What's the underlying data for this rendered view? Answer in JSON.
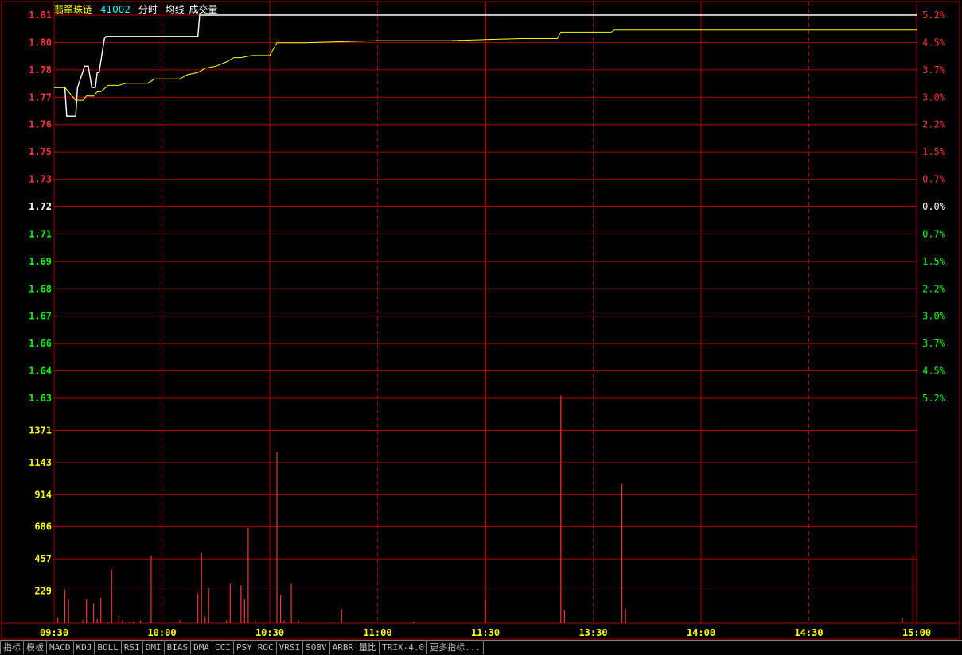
{
  "header": {
    "stock_name": "翡翠珠链",
    "stock_code": "41002",
    "legend": [
      "分时",
      "均线",
      "成交量"
    ]
  },
  "colors": {
    "price_line": "#ffffff",
    "avg_line": "#ffff00",
    "up": "#ff3232",
    "down": "#00ff00",
    "neutral": "#ffffff",
    "grid": "#b40000",
    "volume_axis": "#ffff00"
  },
  "bottom_tabs": [
    "指标",
    "模板",
    "MACD",
    "KDJ",
    "BOLL",
    "RSI",
    "DMI",
    "BIAS",
    "DMA",
    "CCI",
    "PSY",
    "ROC",
    "VRSI",
    "SOBV",
    "ARBR",
    "量比",
    "TRIX-4.0",
    "更多指标..."
  ],
  "chart_data": [
    {
      "type": "line",
      "title": "分时",
      "prev_close": 1.72,
      "price_ticks": [
        {
          "label": "1.81",
          "pct": "5.2%",
          "dir": "up"
        },
        {
          "label": "1.80",
          "pct": "4.5%",
          "dir": "up"
        },
        {
          "label": "1.78",
          "pct": "3.7%",
          "dir": "up"
        },
        {
          "label": "1.77",
          "pct": "3.0%",
          "dir": "up"
        },
        {
          "label": "1.76",
          "pct": "2.2%",
          "dir": "up"
        },
        {
          "label": "1.75",
          "pct": "1.5%",
          "dir": "up"
        },
        {
          "label": "1.73",
          "pct": "0.7%",
          "dir": "up"
        },
        {
          "label": "1.72",
          "pct": "0.0%",
          "dir": "flat"
        },
        {
          "label": "1.71",
          "pct": "0.7%",
          "dir": "down"
        },
        {
          "label": "1.69",
          "pct": "1.5%",
          "dir": "down"
        },
        {
          "label": "1.68",
          "pct": "2.2%",
          "dir": "down"
        },
        {
          "label": "1.67",
          "pct": "3.0%",
          "dir": "down"
        },
        {
          "label": "1.66",
          "pct": "3.7%",
          "dir": "down"
        },
        {
          "label": "1.64",
          "pct": "4.5%",
          "dir": "down"
        },
        {
          "label": "1.63",
          "pct": "5.2%",
          "dir": "down"
        }
      ],
      "ylim": [
        1.63,
        1.81
      ],
      "x_ticks": [
        "09:30",
        "10:00",
        "10:30",
        "11:00",
        "11:30",
        "13:30",
        "14:00",
        "14:30",
        "15:00"
      ],
      "series": [
        {
          "name": "分时",
          "x": [
            0,
            3,
            3.5,
            6,
            6.5,
            8.5,
            9.5,
            10.5,
            11.5,
            12,
            12.5,
            14,
            14.5,
            40,
            40.5,
            240
          ],
          "values": [
            1.776,
            1.776,
            1.7625,
            1.7625,
            1.776,
            1.786,
            1.786,
            1.776,
            1.776,
            1.783,
            1.783,
            1.799,
            1.8,
            1.8,
            1.81,
            1.81
          ]
        },
        {
          "name": "均线",
          "x": [
            0,
            3,
            6,
            8,
            9,
            11,
            12,
            13,
            15,
            18,
            20,
            26,
            28,
            35,
            37,
            40,
            42,
            45,
            48,
            50,
            52,
            55,
            60,
            62,
            64,
            70,
            90,
            110,
            130,
            140,
            141,
            155,
            156,
            240
          ],
          "values": [
            1.776,
            1.776,
            1.77,
            1.77,
            1.772,
            1.772,
            1.774,
            1.774,
            1.777,
            1.777,
            1.778,
            1.778,
            1.78,
            1.78,
            1.782,
            1.783,
            1.785,
            1.786,
            1.788,
            1.79,
            1.79,
            1.791,
            1.791,
            1.797,
            1.797,
            1.797,
            1.798,
            1.798,
            1.799,
            1.799,
            1.802,
            1.802,
            1.803,
            1.803
          ]
        }
      ]
    },
    {
      "type": "bar",
      "title": "成交量",
      "y_ticks": [
        "1371",
        "1143",
        "914",
        "686",
        "457",
        "229"
      ],
      "ylim": [
        0,
        1600
      ],
      "series": [
        {
          "name": "成交量",
          "x": [
            1,
            3,
            4,
            8,
            9,
            11,
            12,
            13,
            15,
            16,
            18,
            19,
            21,
            22,
            24,
            27,
            35,
            40,
            41,
            42,
            43,
            48,
            49,
            52,
            53,
            54,
            56,
            62,
            63,
            64,
            66,
            68,
            80,
            100,
            120,
            141,
            142,
            158,
            159,
            236,
            239
          ],
          "values": [
            40,
            240,
            170,
            20,
            170,
            140,
            30,
            180,
            10,
            380,
            50,
            20,
            10,
            10,
            20,
            480,
            20,
            210,
            500,
            50,
            250,
            20,
            280,
            270,
            170,
            680,
            20,
            1220,
            200,
            20,
            280,
            20,
            100,
            10,
            170,
            1620,
            90,
            990,
            100,
            40,
            480
          ]
        }
      ]
    }
  ]
}
